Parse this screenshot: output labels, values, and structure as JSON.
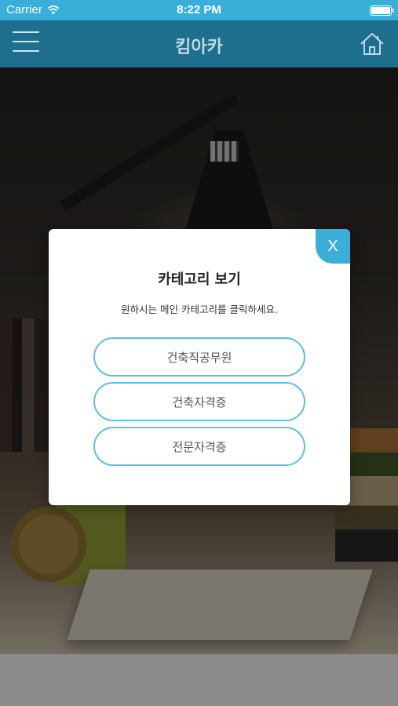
{
  "status_bar": {
    "carrier": "Carrier",
    "time": "8:22 PM"
  },
  "nav": {
    "title": "킴아카"
  },
  "dialog": {
    "close_label": "X",
    "title": "카테고리 보기",
    "subtitle": "원하시는 메인 카테고리를 클릭하세요.",
    "categories": [
      {
        "label": "건축직공무원"
      },
      {
        "label": "건축자격증"
      },
      {
        "label": "전문자격증"
      }
    ]
  },
  "colors": {
    "accent": "#3aaed9",
    "nav_bar": "#1e6e8d",
    "button_border": "#5cbfe3"
  }
}
